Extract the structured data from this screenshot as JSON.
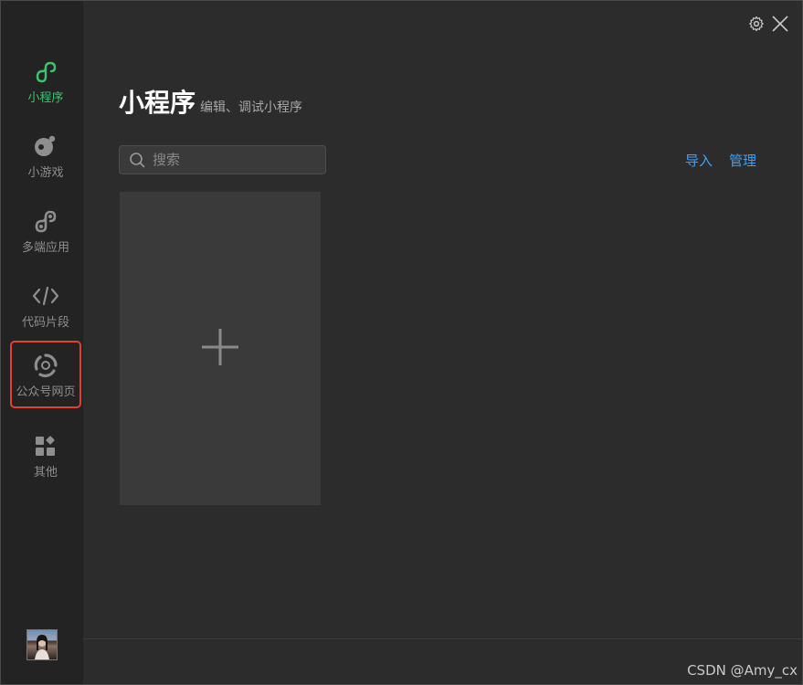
{
  "sidebar": {
    "items": [
      {
        "label": "小程序",
        "icon": "mini-program-icon",
        "active": true
      },
      {
        "label": "小游戏",
        "icon": "mini-game-icon"
      },
      {
        "label": "多端应用",
        "icon": "multi-platform-icon"
      },
      {
        "label": "代码片段",
        "icon": "code-snippet-icon"
      },
      {
        "label": "公众号网页",
        "icon": "official-account-web-icon",
        "highlighted": true
      },
      {
        "label": "其他",
        "icon": "other-apps-icon"
      }
    ],
    "avatar_icon": "user-avatar"
  },
  "topbar": {
    "settings_icon": "gear-icon",
    "close_icon": "close-icon"
  },
  "main": {
    "title": "小程序",
    "subtitle": "编辑、调试小程序",
    "search": {
      "placeholder": "搜索",
      "value": ""
    },
    "actions": {
      "import_label": "导入",
      "manage_label": "管理"
    },
    "create_card_icon": "plus-icon"
  },
  "watermark": "CSDN @Amy_cx",
  "colors": {
    "accent_green": "#3cc46c",
    "link_blue": "#3ba0ff",
    "highlight_red": "#e0402c",
    "background": "#2c2c2c",
    "sidebar_background": "#232323"
  }
}
